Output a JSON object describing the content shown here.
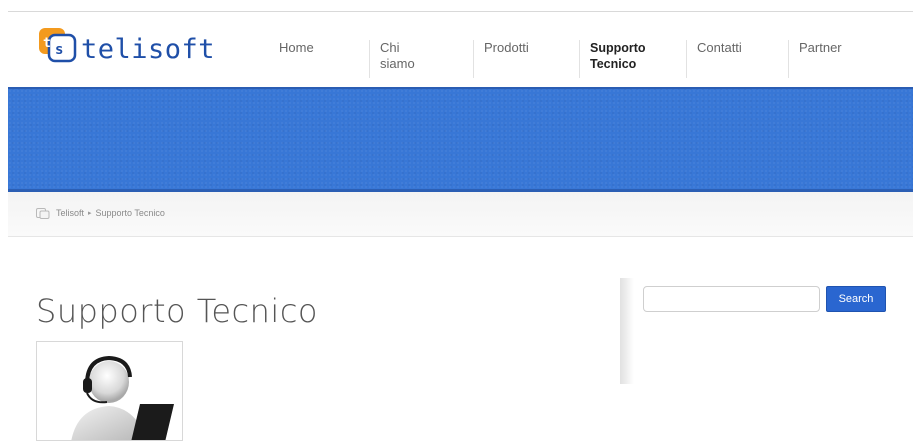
{
  "brand": {
    "logo_text": "telisoft",
    "logo_mark": "ts"
  },
  "nav": {
    "items": [
      {
        "label": "Home"
      },
      {
        "label": "Chi siamo"
      },
      {
        "label": "Prodotti"
      },
      {
        "label": "Supporto Tecnico",
        "active": true
      },
      {
        "label": "Contatti"
      },
      {
        "label": "Partner"
      }
    ]
  },
  "breadcrumb": {
    "icon": "home-icon",
    "items": [
      "Telisoft",
      "Supporto Tecnico"
    ],
    "separator": "▸"
  },
  "page": {
    "title": "Supporto Tecnico"
  },
  "search": {
    "placeholder": "",
    "value": "",
    "button_label": "Search"
  },
  "colors": {
    "brand_blue": "#1f4fa8",
    "banner_blue": "#3877d6",
    "button_blue": "#2a66d0",
    "logo_orange": "#f39a1e"
  }
}
